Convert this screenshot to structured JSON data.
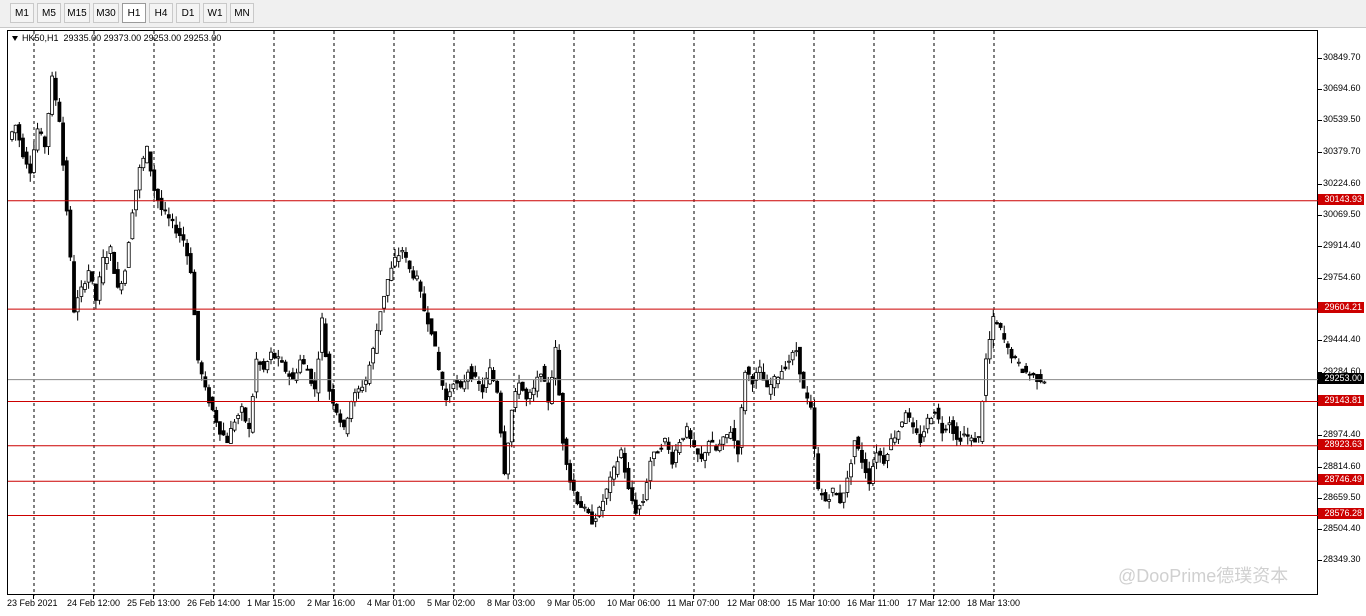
{
  "toolbar": {
    "timeframes": [
      {
        "label": "M1",
        "active": false
      },
      {
        "label": "M5",
        "active": false
      },
      {
        "label": "M15",
        "active": false
      },
      {
        "label": "M30",
        "active": false
      },
      {
        "label": "H1",
        "active": true
      },
      {
        "label": "H4",
        "active": false
      },
      {
        "label": "D1",
        "active": false
      },
      {
        "label": "W1",
        "active": false
      },
      {
        "label": "MN",
        "active": false
      }
    ]
  },
  "chart_header": {
    "symbol": "HK50,H1",
    "ohlc": "29335.00 29373.00 29253.00 29253.00"
  },
  "chart_data": {
    "type": "candlestick",
    "symbol": "HK50",
    "timeframe": "H1",
    "y_range": [
      28349.3,
      30930
    ],
    "price_ticks": [
      "30849.70",
      "30694.60",
      "30539.50",
      "30379.70",
      "30224.60",
      "30069.50",
      "29914.40",
      "29754.60",
      "29444.40",
      "29284.60",
      "28974.40",
      "28814.60",
      "28659.50",
      "28504.40",
      "28349.30"
    ],
    "time_labels": [
      "23 Feb 2021",
      "24 Feb 12:00",
      "25 Feb 13:00",
      "26 Feb 14:00",
      "1 Mar 15:00",
      "2 Mar 16:00",
      "4 Mar 01:00",
      "5 Mar 02:00",
      "8 Mar 03:00",
      "9 Mar 05:00",
      "10 Mar 06:00",
      "11 Mar 07:00",
      "12 Mar 08:00",
      "15 Mar 10:00",
      "16 Mar 11:00",
      "17 Mar 12:00",
      "18 Mar 13:00"
    ],
    "horizontal_levels": [
      "30143.93",
      "29604.21",
      "29143.81",
      "28923.63",
      "28746.49",
      "28576.28"
    ],
    "current_price": "29253.00",
    "level_color": "#cc0000",
    "current_price_color": "#000000",
    "bull_color": "#000000",
    "bear_color": "#000000",
    "grid": "vertical-dashed",
    "price_path": [
      [
        0,
        30450
      ],
      [
        1,
        30520
      ],
      [
        2,
        30380
      ],
      [
        3,
        30300
      ],
      [
        4,
        30500
      ],
      [
        5,
        30420
      ],
      [
        6,
        30750
      ],
      [
        7,
        30550
      ],
      [
        8,
        30100
      ],
      [
        9,
        29600
      ],
      [
        10,
        29700
      ],
      [
        11,
        29800
      ],
      [
        12,
        29650
      ],
      [
        13,
        29850
      ],
      [
        14,
        29900
      ],
      [
        15,
        29700
      ],
      [
        16,
        29800
      ],
      [
        17,
        30100
      ],
      [
        18,
        30300
      ],
      [
        19,
        30400
      ],
      [
        20,
        30200
      ],
      [
        21,
        30100
      ],
      [
        22,
        30050
      ],
      [
        23,
        30000
      ],
      [
        24,
        29950
      ],
      [
        25,
        29800
      ],
      [
        26,
        29350
      ],
      [
        27,
        29200
      ],
      [
        28,
        29100
      ],
      [
        29,
        29000
      ],
      [
        30,
        28950
      ],
      [
        31,
        29050
      ],
      [
        32,
        29100
      ],
      [
        33,
        29000
      ],
      [
        34,
        29350
      ],
      [
        35,
        29300
      ],
      [
        36,
        29380
      ],
      [
        37,
        29350
      ],
      [
        38,
        29300
      ],
      [
        39,
        29250
      ],
      [
        40,
        29350
      ],
      [
        41,
        29300
      ],
      [
        42,
        29200
      ],
      [
        43,
        29550
      ],
      [
        44,
        29200
      ],
      [
        45,
        29100
      ],
      [
        46,
        29000
      ],
      [
        47,
        29150
      ],
      [
        48,
        29200
      ],
      [
        49,
        29250
      ],
      [
        50,
        29400
      ],
      [
        51,
        29600
      ],
      [
        52,
        29750
      ],
      [
        53,
        29850
      ],
      [
        54,
        29900
      ],
      [
        55,
        29800
      ],
      [
        56,
        29750
      ],
      [
        57,
        29600
      ],
      [
        58,
        29500
      ],
      [
        59,
        29300
      ],
      [
        60,
        29150
      ],
      [
        61,
        29250
      ],
      [
        62,
        29200
      ],
      [
        63,
        29300
      ],
      [
        64,
        29250
      ],
      [
        65,
        29200
      ],
      [
        66,
        29300
      ],
      [
        67,
        29200
      ],
      [
        68,
        28800
      ],
      [
        69,
        29100
      ],
      [
        70,
        29250
      ],
      [
        71,
        29150
      ],
      [
        72,
        29200
      ],
      [
        73,
        29300
      ],
      [
        74,
        29150
      ],
      [
        75,
        29400
      ],
      [
        76,
        28950
      ],
      [
        77,
        28750
      ],
      [
        78,
        28650
      ],
      [
        79,
        28600
      ],
      [
        80,
        28550
      ],
      [
        81,
        28600
      ],
      [
        82,
        28700
      ],
      [
        83,
        28800
      ],
      [
        84,
        28900
      ],
      [
        85,
        28700
      ],
      [
        86,
        28600
      ],
      [
        87,
        28650
      ],
      [
        88,
        28850
      ],
      [
        89,
        28900
      ],
      [
        90,
        28950
      ],
      [
        91,
        28850
      ],
      [
        92,
        28950
      ],
      [
        93,
        29000
      ],
      [
        94,
        28900
      ],
      [
        95,
        28850
      ],
      [
        96,
        28950
      ],
      [
        97,
        28900
      ],
      [
        98,
        28950
      ],
      [
        99,
        29000
      ],
      [
        100,
        28900
      ],
      [
        101,
        29300
      ],
      [
        102,
        29250
      ],
      [
        103,
        29300
      ],
      [
        104,
        29200
      ],
      [
        105,
        29250
      ],
      [
        106,
        29300
      ],
      [
        107,
        29350
      ],
      [
        108,
        29400
      ],
      [
        109,
        29200
      ],
      [
        110,
        29100
      ],
      [
        111,
        28700
      ],
      [
        112,
        28650
      ],
      [
        113,
        28700
      ],
      [
        114,
        28650
      ],
      [
        115,
        28750
      ],
      [
        116,
        28950
      ],
      [
        117,
        28850
      ],
      [
        118,
        28750
      ],
      [
        119,
        28900
      ],
      [
        120,
        28850
      ],
      [
        121,
        28950
      ],
      [
        122,
        29000
      ],
      [
        123,
        29100
      ],
      [
        124,
        29000
      ],
      [
        125,
        28950
      ],
      [
        126,
        29050
      ],
      [
        127,
        29100
      ],
      [
        128,
        29000
      ],
      [
        129,
        29050
      ],
      [
        130,
        28950
      ],
      [
        131,
        28980
      ],
      [
        132,
        28950
      ],
      [
        133,
        28960
      ],
      [
        134,
        29350
      ],
      [
        135,
        29550
      ],
      [
        136,
        29500
      ],
      [
        137,
        29400
      ],
      [
        138,
        29350
      ],
      [
        139,
        29300
      ],
      [
        140,
        29280
      ],
      [
        141,
        29260
      ],
      [
        142,
        29253
      ]
    ]
  },
  "watermark": "@DooPrime德璞资本"
}
